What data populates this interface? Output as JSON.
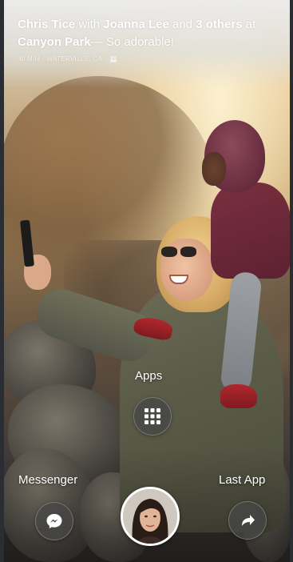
{
  "story": {
    "author": "Chris Tice",
    "with_word": "with",
    "tagged": "Joanna Lee",
    "and_word": "and",
    "others": "3 others",
    "at_word": "at",
    "place": "Canyon Park",
    "caption": "— So adorable!",
    "meta_time": "30 MIN",
    "meta_location": "WATERVILLE, CA",
    "meta_separator": "·",
    "meta_icon": "people-icon"
  },
  "launcher": {
    "apps_label": "Apps",
    "apps_icon": "grid-icon",
    "messenger_label": "Messenger",
    "messenger_icon": "messenger-bubble-icon",
    "last_app_label": "Last App",
    "last_app_icon": "curved-arrow-icon",
    "avatar_icon": "profile-avatar"
  }
}
